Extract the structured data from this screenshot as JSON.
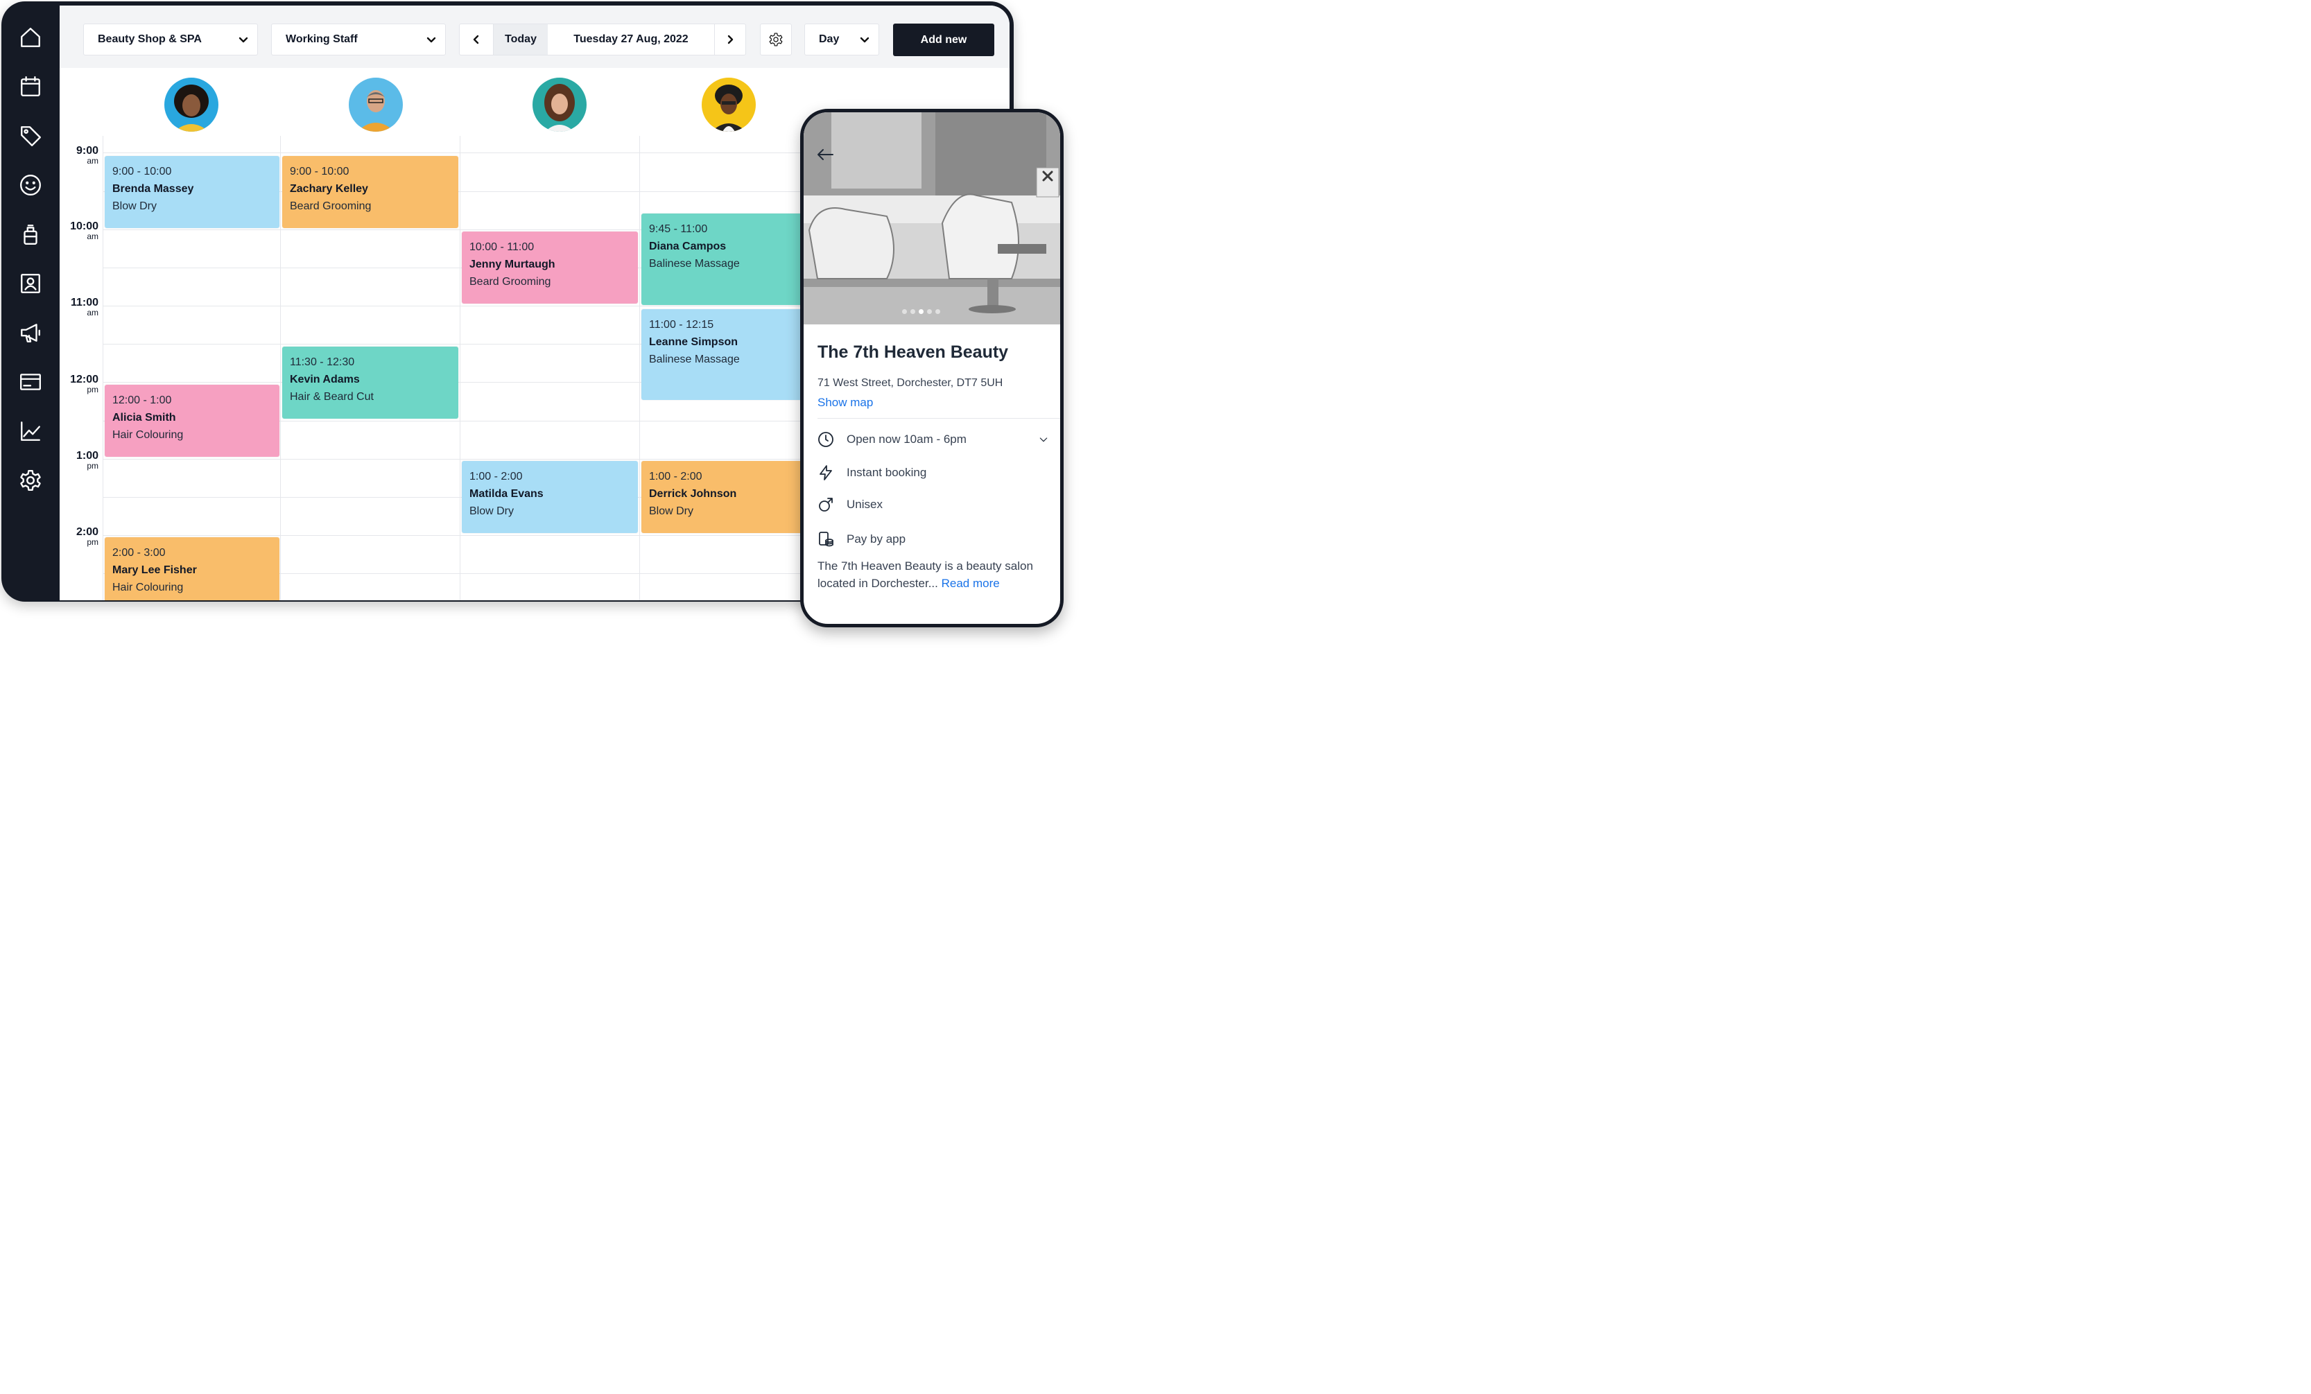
{
  "toolbar": {
    "location": "Beauty Shop & SPA",
    "staff_filter": "Working Staff",
    "today_label": "Today",
    "date": "Tuesday 27 Aug, 2022",
    "view": "Day",
    "add_new": "Add new"
  },
  "times": [
    {
      "t": "9:00",
      "ap": "am"
    },
    {
      "t": "10:00",
      "ap": "am"
    },
    {
      "t": "11:00",
      "ap": "am"
    },
    {
      "t": "12:00",
      "ap": "pm"
    },
    {
      "t": "1:00",
      "ap": "pm"
    },
    {
      "t": "2:00",
      "ap": "pm"
    }
  ],
  "appointments": [
    {
      "time": "9:00 - 10:00",
      "name": "Brenda Massey",
      "service": "Blow Dry"
    },
    {
      "time": "9:00 - 10:00",
      "name": "Zachary Kelley",
      "service": "Beard Grooming"
    },
    {
      "time": "9:45 - 11:00",
      "name": "Diana Campos",
      "service": "Balinese Massage"
    },
    {
      "time": "10:00 - 11:00",
      "name": "Jenny Murtaugh",
      "service": "Beard Grooming"
    },
    {
      "time": "11:00 - 12:15",
      "name": "Leanne Simpson",
      "service": "Balinese Massage"
    },
    {
      "time": "11:30 - 12:30",
      "name": "Kevin Adams",
      "service": "Hair & Beard Cut"
    },
    {
      "time": "12:00 - 1:00",
      "name": "Alicia Smith",
      "service": "Hair Colouring"
    },
    {
      "time": "1:00 - 2:00",
      "name": "Matilda Evans",
      "service": "Blow Dry"
    },
    {
      "time": "1:00 - 2:00",
      "name": "Derrick Johnson",
      "service": "Blow Dry"
    },
    {
      "time": "2:00 - 3:00",
      "name": "Mary Lee Fisher",
      "service": "Hair Colouring"
    }
  ],
  "salon": {
    "name": "The 7th Heaven Beauty",
    "address": "71 West Street, Dorchester, DT7 5UH",
    "show_map": "Show map",
    "hours": "Open now 10am - 6pm",
    "booking": "Instant booking",
    "gender": "Unisex",
    "payment": "Pay by app",
    "description": "The 7th Heaven Beauty is a beauty salon located in Dorchester...",
    "read_more": "Read more"
  },
  "colors": {
    "sidebar": "#151a25",
    "blue": "#a8ddf6",
    "orange": "#f9bd6a",
    "pink": "#f6a0c1",
    "teal": "#6ed6c6",
    "link": "#1a73e8"
  },
  "icons": [
    "home-icon",
    "calendar-icon",
    "tag-icon",
    "smiley-icon",
    "bottle-icon",
    "contact-card-icon",
    "megaphone-icon",
    "payment-card-icon",
    "chart-icon",
    "gear-icon"
  ]
}
